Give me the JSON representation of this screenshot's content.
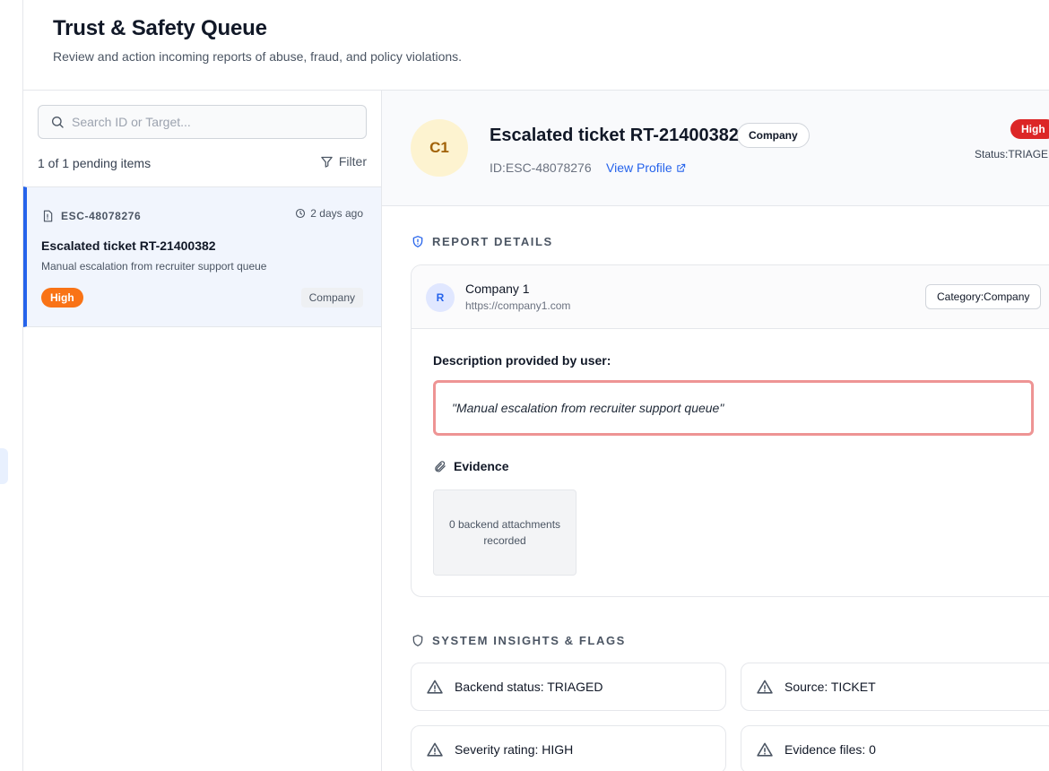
{
  "header": {
    "title": "Trust & Safety Queue",
    "subtitle": "Review and action incoming reports of abuse, fraud, and policy violations."
  },
  "queue": {
    "search_placeholder": "Search ID or Target...",
    "count_text": "1 of 1 pending items",
    "filter_label": "Filter",
    "items": [
      {
        "id": "ESC-48078276",
        "time": "2 days ago",
        "title": "Escalated ticket RT-21400382",
        "description": "Manual escalation from recruiter support queue",
        "severity": "High",
        "type": "Company"
      }
    ]
  },
  "detail": {
    "avatar_initials": "C1",
    "title": "Escalated ticket RT-21400382",
    "type_pill": "Company",
    "id_text": "ID:ESC-48078276",
    "view_profile": "View Profile",
    "severity": "High",
    "status_text": "Status:TRIAGED",
    "report_section_title": "REPORT DETAILS",
    "reporter": {
      "initial": "R",
      "name": "Company 1",
      "url": "https://company1.com"
    },
    "category_text": "Category:Company",
    "description_label": "Description provided by user:",
    "description_quote": "\"Manual escalation from recruiter support queue\"",
    "evidence_title": "Evidence",
    "evidence_empty": "0 backend attachments recorded",
    "insights_title": "SYSTEM INSIGHTS & FLAGS",
    "flags": [
      "Backend status: TRIAGED",
      "Source: TICKET",
      "Severity rating: HIGH",
      "Evidence files: 0"
    ]
  },
  "colors": {
    "accent": "#2563eb",
    "severity_high_queue": "#f97316",
    "severity_high_detail": "#dc2626",
    "description_border": "#ee9494"
  }
}
